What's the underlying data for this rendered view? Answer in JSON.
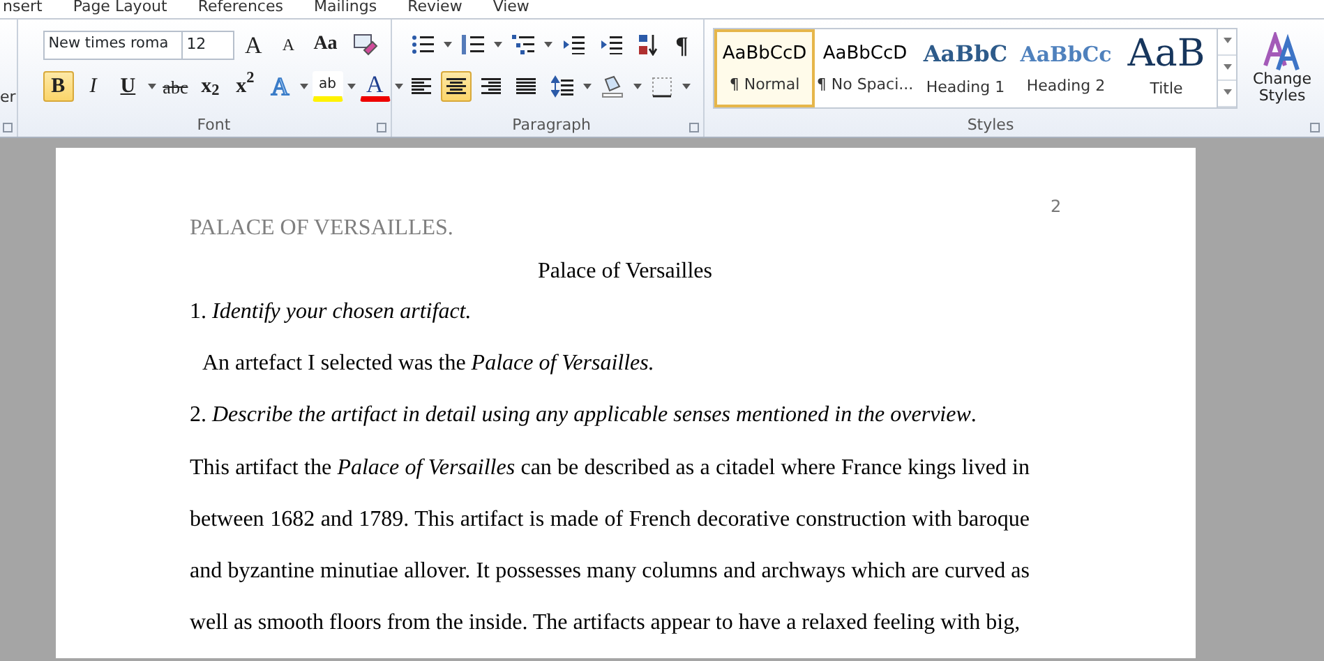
{
  "ribbon_tabs": [
    {
      "label": "nsert"
    },
    {
      "label": "Page Layout"
    },
    {
      "label": "References"
    },
    {
      "label": "Mailings"
    },
    {
      "label": "Review"
    },
    {
      "label": "View"
    }
  ],
  "clipboard": {
    "label_fragment": "er"
  },
  "font_group": {
    "title": "Font",
    "font_name": "New times roma",
    "font_size": "12",
    "row1": [
      {
        "kind": "grow",
        "label": "A"
      },
      {
        "kind": "shrink",
        "label": "A"
      },
      {
        "kind": "case",
        "label": "Aa"
      },
      {
        "kind": "clear"
      }
    ],
    "row2": [
      {
        "kind": "bold",
        "label": "B",
        "selected": true
      },
      {
        "kind": "italic",
        "label": "I",
        "selected": false
      },
      {
        "kind": "underline",
        "label": "U",
        "selected": false
      },
      {
        "kind": "strike",
        "label": "abc",
        "selected": false
      },
      {
        "kind": "script",
        "label": "x$_{2}$",
        "selected": false
      },
      {
        "kind": "script",
        "label": "x$^{2}$",
        "selected": false
      },
      {
        "kind": "effects",
        "label": "A",
        "selected": false
      },
      {
        "kind": "highlight",
        "label": "ab",
        "selected": false
      },
      {
        "kind": "color",
        "label": "A",
        "selected": false
      }
    ]
  },
  "paragraph_group": {
    "title": "Paragraph",
    "row1": [
      {
        "kind": "bullets"
      },
      {
        "kind": "numbering"
      },
      {
        "kind": "multilevel"
      },
      {
        "kind": "outdent"
      },
      {
        "kind": "indent"
      },
      {
        "kind": "sort"
      },
      {
        "kind": "pilcrow",
        "label": "¶"
      }
    ],
    "row2": [
      {
        "kind": "left",
        "selected": false
      },
      {
        "kind": "center",
        "selected": true
      },
      {
        "kind": "right",
        "selected": false
      },
      {
        "kind": "justify",
        "selected": false
      },
      {
        "kind": "spacing",
        "selected": false
      },
      {
        "kind": "shading",
        "selected": false
      },
      {
        "kind": "borders",
        "selected": false
      }
    ]
  },
  "styles_group": {
    "title": "Styles",
    "change_styles": "Change Styles",
    "items": [
      {
        "kind": "normal",
        "preview": "AaBbCcD",
        "name": "¶ Normal",
        "selected": true
      },
      {
        "kind": "normal",
        "preview": "AaBbCcD",
        "name": "¶ No Spaci...",
        "selected": false
      },
      {
        "kind": "heading1",
        "preview": "AaBbC",
        "name": "Heading 1",
        "selected": false
      },
      {
        "kind": "heading2",
        "preview": "AaBbCc",
        "name": "Heading 2",
        "selected": false
      },
      {
        "kind": "title",
        "preview": "AaB",
        "name": "Title",
        "selected": false
      }
    ]
  },
  "document": {
    "page_number": "2",
    "header": "PALACE OF VERSAILLES.",
    "title": "Palace of Versailles",
    "paragraphs": [
      {
        "kind": "prompt",
        "text": "1. *Identify your chosen artifact.*"
      },
      {
        "kind": "answer",
        "text": "An artefact I selected was the *Palace of Versailles.*"
      },
      {
        "kind": "prompt",
        "text": "2. *Describe the artifact in detail using any applicable senses mentioned in the overview*."
      },
      {
        "kind": "body",
        "text": "This artifact the *Palace of Versailles* can be described as a citadel where France kings lived in between 1682 and 1789. This artifact is made of French decorative construction with baroque and byzantine minutiae allover.  It possesses many columns and archways which are curved as well as smooth floors from the inside. The artifacts appear to have a relaxed feeling with big,"
      }
    ]
  }
}
